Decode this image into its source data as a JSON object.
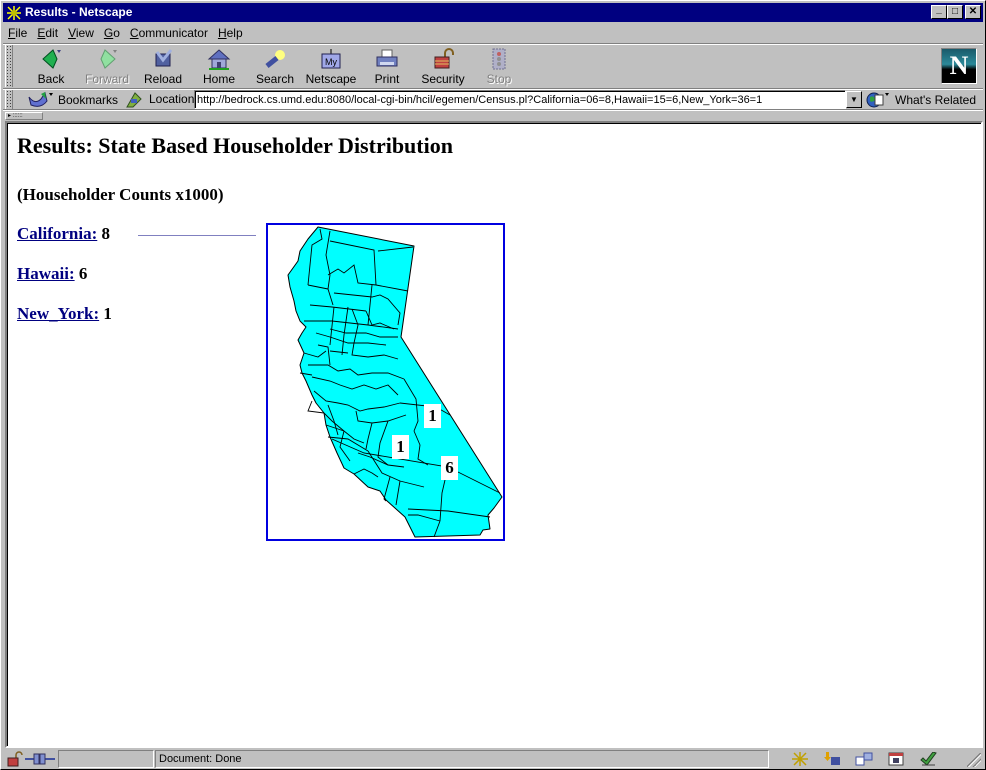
{
  "window": {
    "title": "Results - Netscape",
    "controls": {
      "minimize": "_",
      "maximize": "□",
      "close": "✕"
    }
  },
  "menu": [
    {
      "label": "File",
      "accel": "F",
      "rest": "ile"
    },
    {
      "label": "Edit",
      "accel": "E",
      "rest": "dit"
    },
    {
      "label": "View",
      "accel": "V",
      "rest": "iew"
    },
    {
      "label": "Go",
      "accel": "G",
      "rest": "o"
    },
    {
      "label": "Communicator",
      "accel": "C",
      "rest": "ommunicator"
    },
    {
      "label": "Help",
      "accel": "H",
      "rest": "elp"
    }
  ],
  "toolbar": {
    "buttons": [
      {
        "label": "Back",
        "icon": "back-arrow-icon",
        "enabled": true
      },
      {
        "label": "Forward",
        "icon": "forward-arrow-icon",
        "enabled": false
      },
      {
        "label": "Reload",
        "icon": "reload-icon",
        "enabled": true
      },
      {
        "label": "Home",
        "icon": "home-icon",
        "enabled": true
      },
      {
        "label": "Search",
        "icon": "search-icon",
        "enabled": true
      },
      {
        "label": "Netscape",
        "icon": "my-netscape-icon",
        "enabled": true
      },
      {
        "label": "Print",
        "icon": "printer-icon",
        "enabled": true
      },
      {
        "label": "Security",
        "icon": "padlock-icon",
        "enabled": true
      },
      {
        "label": "Stop",
        "icon": "stop-icon",
        "enabled": false
      }
    ],
    "netscape_icon_text": "My",
    "logo_letter": "N"
  },
  "location_bar": {
    "bookmarks_label": "Bookmarks",
    "location_label": "Location:",
    "url": "http://bedrock.cs.umd.edu:8080/local-cgi-bin/hcil/egemen/Census.pl?California=06=8,Hawaii=15=6,New_York=36=1",
    "whats_related_label": "What's Related"
  },
  "page": {
    "title": "Results: State Based Householder Distribution",
    "subtitle": "(Householder Counts x1000)",
    "states": [
      {
        "name": "California:",
        "value": "8"
      },
      {
        "name": "Hawaii:",
        "value": "6"
      },
      {
        "name": "New_York:",
        "value": "1"
      }
    ],
    "map": {
      "state": "California",
      "fill_color": "#00ffff",
      "border_color": "#0000e0",
      "county_labels": [
        "1",
        "1",
        "6"
      ]
    }
  },
  "status_bar": {
    "text": "Document: Done"
  }
}
